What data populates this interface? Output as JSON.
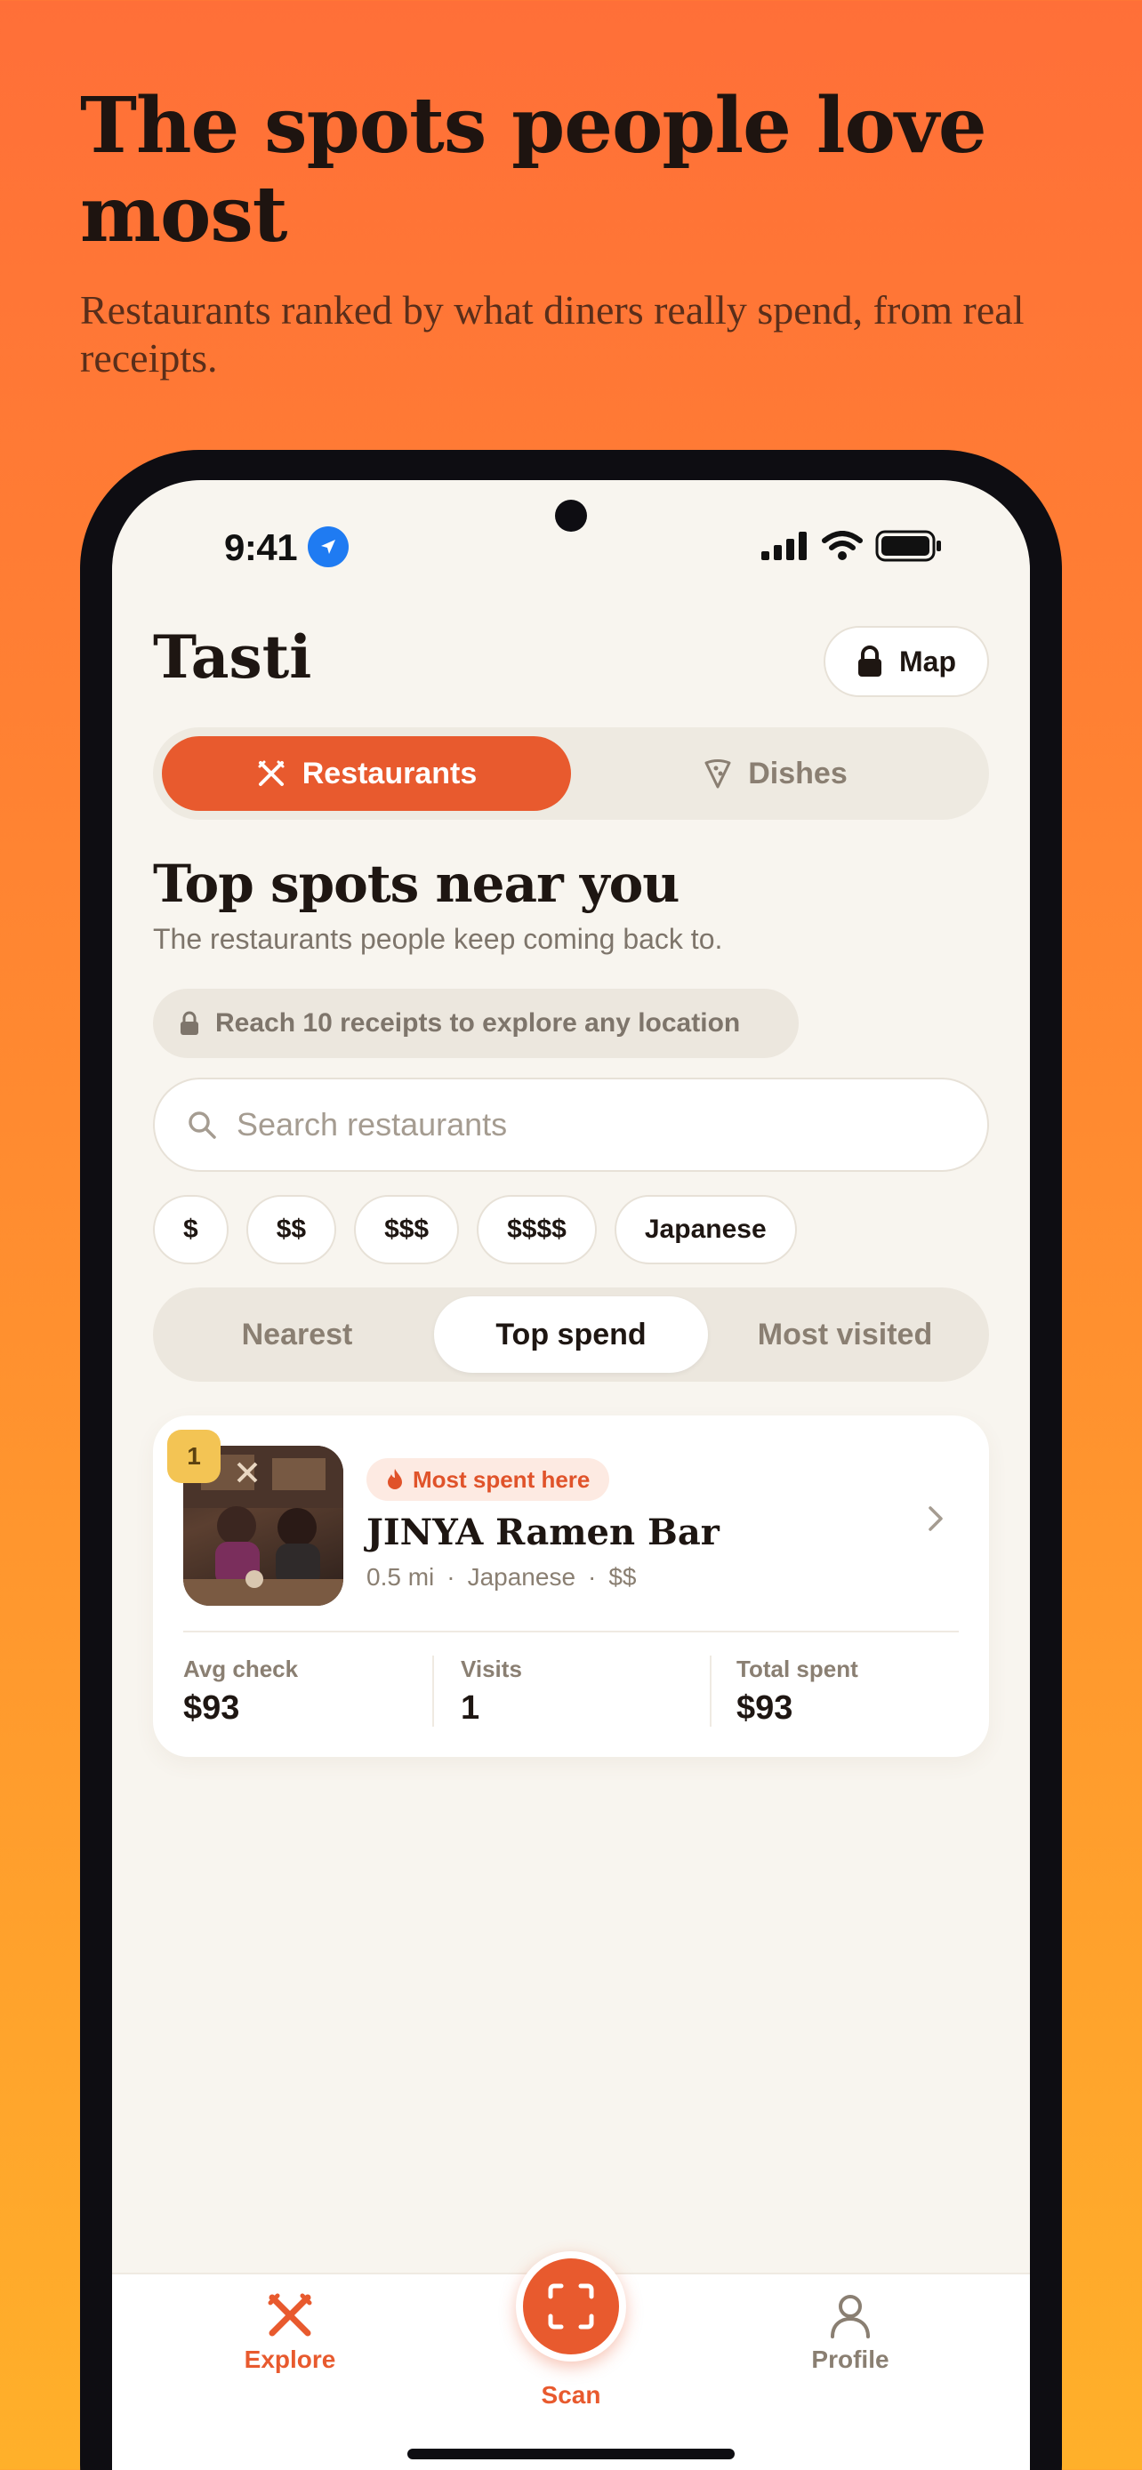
{
  "hero": {
    "title": "The spots people love most",
    "subtitle": "Restaurants ranked by what diners really spend, from real receipts."
  },
  "status_bar": {
    "time": "9:41"
  },
  "header": {
    "app_name": "Tasti",
    "map_label": "Map"
  },
  "mode_tabs": [
    {
      "label": "Restaurants",
      "icon": "fork-knife-icon",
      "active": true
    },
    {
      "label": "Dishes",
      "icon": "pizza-slice-icon",
      "active": false
    }
  ],
  "section": {
    "title": "Top spots near you",
    "subtitle": "The restaurants people keep coming back to."
  },
  "lock_notice": "Reach 10 receipts to explore any location",
  "search": {
    "placeholder": "Search restaurants",
    "value": ""
  },
  "filters": [
    "$",
    "$$",
    "$$$",
    "$$$$",
    "Japanese"
  ],
  "sort_options": [
    {
      "label": "Nearest",
      "active": false
    },
    {
      "label": "Top spend",
      "active": true
    },
    {
      "label": "Most visited",
      "active": false
    }
  ],
  "restaurants": [
    {
      "rank": "1",
      "badge": "Most spent here",
      "name": "JINYA Ramen Bar",
      "distance": "0.5 mi",
      "cuisine": "Japanese",
      "price": "$$",
      "stats": [
        {
          "label": "Avg check",
          "value": "$93"
        },
        {
          "label": "Visits",
          "value": "1"
        },
        {
          "label": "Total spent",
          "value": "$93"
        }
      ]
    }
  ],
  "tab_bar": {
    "explore": "Explore",
    "scan": "Scan",
    "profile": "Profile"
  },
  "colors": {
    "accent": "#E85A2E",
    "background": "#F8F5EF",
    "rank_badge": "#F3C454",
    "gradient_top": "#FF6F38",
    "gradient_bottom": "#FFB02A"
  }
}
